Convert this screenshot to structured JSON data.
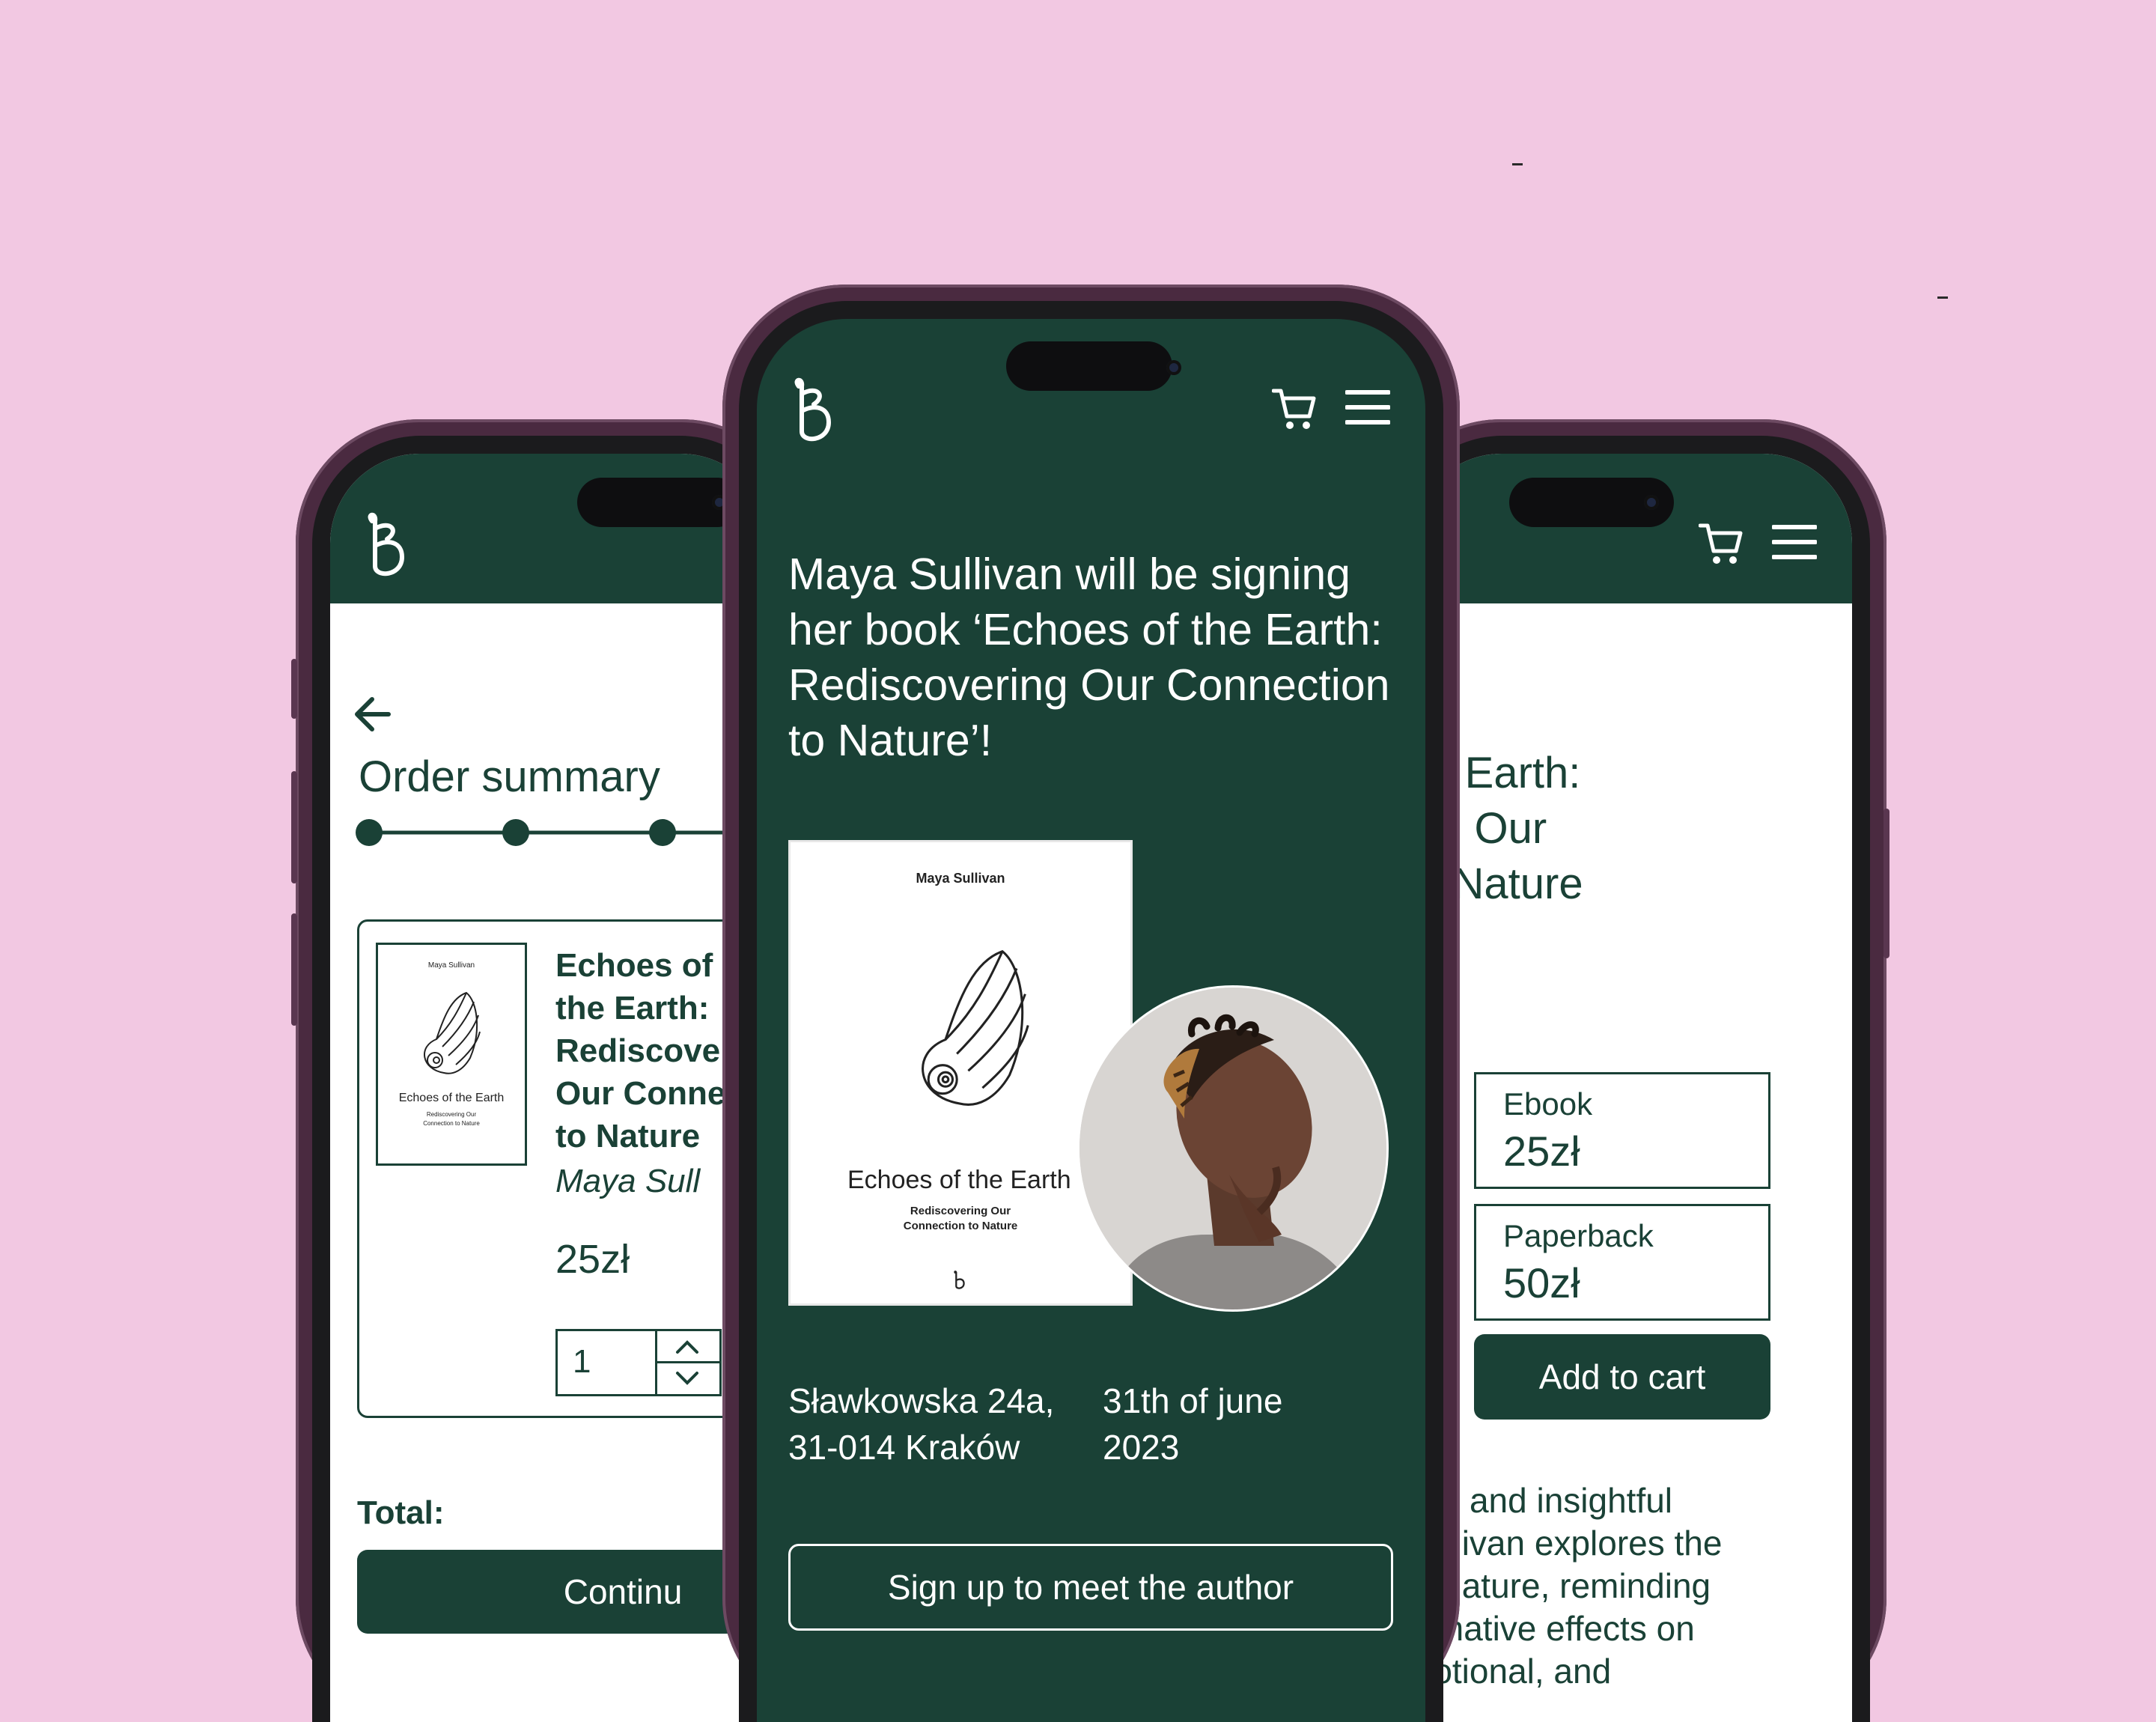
{
  "colors": {
    "background": "#f2c8e2",
    "brand_green": "#1a4136",
    "white": "#ffffff"
  },
  "center_phone": {
    "header_icons": [
      "logo-icon",
      "cart-icon",
      "menu-icon"
    ],
    "headline": "Maya Sullivan will be signing her book ‘Echoes of the Earth: Rediscovering Our Connection to Nature’!",
    "cover": {
      "author": "Maya Sullivan",
      "title": "Echoes of the Earth",
      "subtitle_line1": "Rediscovering Our",
      "subtitle_line2": "Connection to Nature"
    },
    "address_line1": "Sławkowska 24a,",
    "address_line2": "31-014 Kraków",
    "date_line1": "31th of june",
    "date_line2": "2023",
    "signup_button": "Sign up to meet the author"
  },
  "left_phone": {
    "back_icon": "arrow-left-icon",
    "title": "Order summary",
    "steps": 3,
    "item": {
      "cover_author": "Maya Sullivan",
      "cover_title": "Echoes of the Earth",
      "cover_sub1": "Rediscovering Our",
      "cover_sub2": "Connection to Nature",
      "title_line1": "Echoes of",
      "title_line2": "the Earth:",
      "title_line3": "Rediscove",
      "title_line4": "Our Conne",
      "title_line5": "to Nature",
      "author": "Maya Sull",
      "price": "25zł",
      "quantity": "1"
    },
    "total_label": "Total:",
    "continue_button": "Continu"
  },
  "right_phone": {
    "title_line1": "he Earth:",
    "title_line2": "ing Our",
    "title_line3": "to Nature",
    "options": [
      {
        "label": "Ebook",
        "price": "25zł"
      },
      {
        "label": "Paperback",
        "price": "50zł"
      }
    ],
    "add_to_cart": "Add to cart",
    "description_lines": [
      "ose and insightful",
      "Sullivan explores the",
      "of nature, reminding",
      "ormative effects on",
      "motional, and"
    ]
  }
}
